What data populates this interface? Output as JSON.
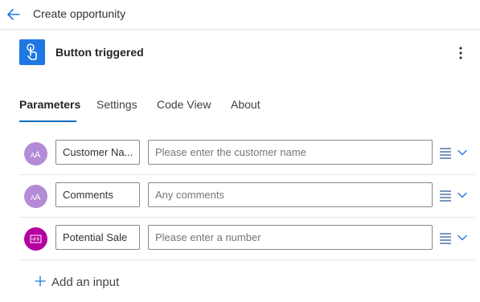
{
  "header": {
    "title": "Create opportunity"
  },
  "trigger": {
    "title": "Button triggered"
  },
  "tabs": [
    {
      "label": "Parameters",
      "active": true
    },
    {
      "label": "Settings",
      "active": false
    },
    {
      "label": "Code View",
      "active": false
    },
    {
      "label": "About",
      "active": false
    }
  ],
  "inputs": [
    {
      "type_icon": "text-type-icon",
      "name": "Customer Name",
      "name_shown": "Customer Na...",
      "description_placeholder": "Please enter the customer name"
    },
    {
      "type_icon": "text-type-icon",
      "name": "Comments",
      "name_shown": "Comments",
      "description_placeholder": "Any comments"
    },
    {
      "type_icon": "number-type-icon",
      "name": "Potential Sale",
      "name_shown": "Potential Sale",
      "description_placeholder": "Please enter a number"
    }
  ],
  "add_input": {
    "label": "Add an input"
  },
  "colors": {
    "accent": "#0f6cbd",
    "trigger_icon_bg": "#1e77e3",
    "text_type_avatar": "#b38bd6",
    "number_type_avatar": "#b4009e"
  }
}
